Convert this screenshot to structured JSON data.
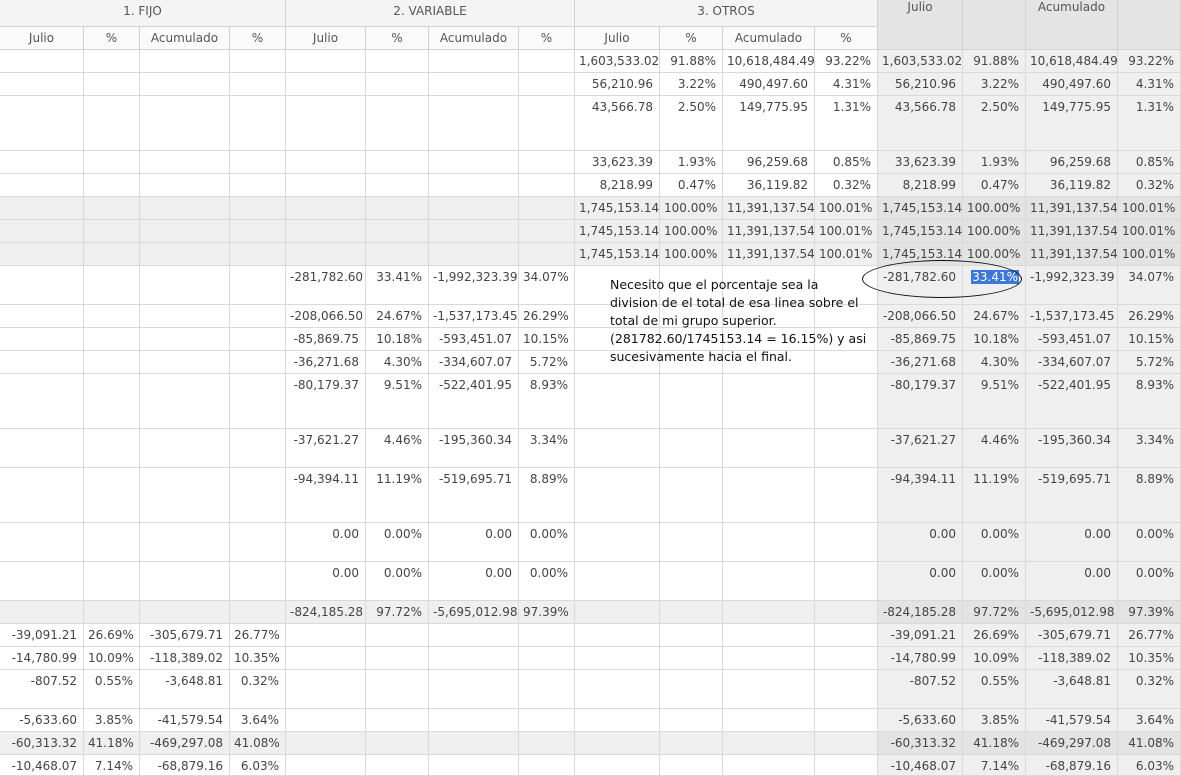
{
  "groups": [
    {
      "label": "1. FIJO"
    },
    {
      "label": "2. VARIABLE"
    },
    {
      "label": "3. OTROS"
    }
  ],
  "summary_headers": {
    "julio": "Julio",
    "acumulado": "Acumulado"
  },
  "sub_headers": [
    "Julio",
    "%",
    "Acumulado",
    "%"
  ],
  "rows": [
    {
      "vals": [
        "",
        "",
        "",
        "",
        "",
        "",
        "",
        "",
        "1,603,533.02",
        "91.88%",
        "10,618,484.49",
        "93.22%",
        "1,603,533.02",
        "91.88%",
        "10,618,484.49",
        "93.22%"
      ],
      "tot": false
    },
    {
      "vals": [
        "",
        "",
        "",
        "",
        "",
        "",
        "",
        "",
        "56,210.96",
        "3.22%",
        "490,497.60",
        "4.31%",
        "56,210.96",
        "3.22%",
        "490,497.60",
        "4.31%"
      ],
      "tot": false
    },
    {
      "vals": [
        "",
        "",
        "",
        "",
        "",
        "",
        "",
        "",
        "43,566.78",
        "2.50%",
        "149,775.95",
        "1.31%",
        "43,566.78",
        "2.50%",
        "149,775.95",
        "1.31%"
      ],
      "tot": false
    },
    {
      "vals": [
        "",
        "",
        "",
        "",
        "",
        "",
        "",
        "",
        "33,623.39",
        "1.93%",
        "96,259.68",
        "0.85%",
        "33,623.39",
        "1.93%",
        "96,259.68",
        "0.85%"
      ],
      "tot": false
    },
    {
      "vals": [
        "",
        "",
        "",
        "",
        "",
        "",
        "",
        "",
        "8,218.99",
        "0.47%",
        "36,119.82",
        "0.32%",
        "8,218.99",
        "0.47%",
        "36,119.82",
        "0.32%"
      ],
      "tot": false
    },
    {
      "vals": [
        "",
        "",
        "",
        "",
        "",
        "",
        "",
        "",
        "1,745,153.14",
        "100.00%",
        "11,391,137.54",
        "100.01%",
        "1,745,153.14",
        "100.00%",
        "11,391,137.54",
        "100.01%"
      ],
      "tot": true
    },
    {
      "vals": [
        "",
        "",
        "",
        "",
        "",
        "",
        "",
        "",
        "1,745,153.14",
        "100.00%",
        "11,391,137.54",
        "100.01%",
        "1,745,153.14",
        "100.00%",
        "11,391,137.54",
        "100.01%"
      ],
      "tot": true
    },
    {
      "vals": [
        "",
        "",
        "",
        "",
        "",
        "",
        "",
        "",
        "1,745,153.14",
        "100.00%",
        "11,391,137.54",
        "100.01%",
        "1,745,153.14",
        "100.00%",
        "11,391,137.54",
        "100.01%"
      ],
      "tot": true
    },
    {
      "vals": [
        "",
        "",
        "",
        "",
        "-281,782.60",
        "33.41%",
        "-1,992,323.39",
        "34.07%",
        "",
        "",
        "",
        "",
        "-281,782.60",
        "33.41%",
        "-1,992,323.39",
        "34.07%"
      ],
      "tot": false
    },
    {
      "vals": [
        "",
        "",
        "",
        "",
        "-208,066.50",
        "24.67%",
        "-1,537,173.45",
        "26.29%",
        "",
        "",
        "",
        "",
        "-208,066.50",
        "24.67%",
        "-1,537,173.45",
        "26.29%"
      ],
      "tot": false
    },
    {
      "vals": [
        "",
        "",
        "",
        "",
        "-85,869.75",
        "10.18%",
        "-593,451.07",
        "10.15%",
        "",
        "",
        "",
        "",
        "-85,869.75",
        "10.18%",
        "-593,451.07",
        "10.15%"
      ],
      "tot": false
    },
    {
      "vals": [
        "",
        "",
        "",
        "",
        "-36,271.68",
        "4.30%",
        "-334,607.07",
        "5.72%",
        "",
        "",
        "",
        "",
        "-36,271.68",
        "4.30%",
        "-334,607.07",
        "5.72%"
      ],
      "tot": false
    },
    {
      "vals": [
        "",
        "",
        "",
        "",
        "-80,179.37",
        "9.51%",
        "-522,401.95",
        "8.93%",
        "",
        "",
        "",
        "",
        "-80,179.37",
        "9.51%",
        "-522,401.95",
        "8.93%"
      ],
      "tot": false
    },
    {
      "vals": [
        "",
        "",
        "",
        "",
        "-37,621.27",
        "4.46%",
        "-195,360.34",
        "3.34%",
        "",
        "",
        "",
        "",
        "-37,621.27",
        "4.46%",
        "-195,360.34",
        "3.34%"
      ],
      "tot": false
    },
    {
      "vals": [
        "",
        "",
        "",
        "",
        "-94,394.11",
        "11.19%",
        "-519,695.71",
        "8.89%",
        "",
        "",
        "",
        "",
        "-94,394.11",
        "11.19%",
        "-519,695.71",
        "8.89%"
      ],
      "tot": false
    },
    {
      "vals": [
        "",
        "",
        "",
        "",
        "0.00",
        "0.00%",
        "0.00",
        "0.00%",
        "",
        "",
        "",
        "",
        "0.00",
        "0.00%",
        "0.00",
        "0.00%"
      ],
      "tot": false
    },
    {
      "vals": [
        "",
        "",
        "",
        "",
        "0.00",
        "0.00%",
        "0.00",
        "0.00%",
        "",
        "",
        "",
        "",
        "0.00",
        "0.00%",
        "0.00",
        "0.00%"
      ],
      "tot": false
    },
    {
      "vals": [
        "",
        "",
        "",
        "",
        "-824,185.28",
        "97.72%",
        "-5,695,012.98",
        "97.39%",
        "",
        "",
        "",
        "",
        "-824,185.28",
        "97.72%",
        "-5,695,012.98",
        "97.39%"
      ],
      "tot": true
    },
    {
      "vals": [
        "-39,091.21",
        "26.69%",
        "-305,679.71",
        "26.77%",
        "",
        "",
        "",
        "",
        "",
        "",
        "",
        "",
        "-39,091.21",
        "26.69%",
        "-305,679.71",
        "26.77%"
      ],
      "tot": false
    },
    {
      "vals": [
        "-14,780.99",
        "10.09%",
        "-118,389.02",
        "10.35%",
        "",
        "",
        "",
        "",
        "",
        "",
        "",
        "",
        "-14,780.99",
        "10.09%",
        "-118,389.02",
        "10.35%"
      ],
      "tot": false
    },
    {
      "vals": [
        "-807.52",
        "0.55%",
        "-3,648.81",
        "0.32%",
        "",
        "",
        "",
        "",
        "",
        "",
        "",
        "",
        "-807.52",
        "0.55%",
        "-3,648.81",
        "0.32%"
      ],
      "tot": false
    },
    {
      "vals": [
        "-5,633.60",
        "3.85%",
        "-41,579.54",
        "3.64%",
        "",
        "",
        "",
        "",
        "",
        "",
        "",
        "",
        "-5,633.60",
        "3.85%",
        "-41,579.54",
        "3.64%"
      ],
      "tot": false
    },
    {
      "vals": [
        "-60,313.32",
        "41.18%",
        "-469,297.08",
        "41.08%",
        "",
        "",
        "",
        "",
        "",
        "",
        "",
        "",
        "-60,313.32",
        "41.18%",
        "-469,297.08",
        "41.08%"
      ],
      "tot": true
    },
    {
      "vals": [
        "-10,468.07",
        "7.14%",
        "-68,879.16",
        "6.03%",
        "",
        "",
        "",
        "",
        "",
        "",
        "",
        "",
        "-10,468.07",
        "7.14%",
        "-68,879.16",
        "6.03%"
      ],
      "tot": false
    }
  ],
  "annotation": {
    "lines": [
      "Necesito que el porcentaje sea la",
      "division de el total de esa linea sobre el",
      "total de mi grupo superior.",
      "(281782.60/1745153.14 = 16.15%) y asi",
      "sucesivamente hacia el final."
    ],
    "highlighted_value": "33.41%"
  }
}
